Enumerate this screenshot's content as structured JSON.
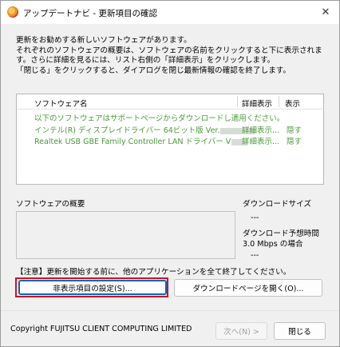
{
  "window": {
    "title": "アップデートナビ - 更新項目の確認",
    "close_glyph": "✕"
  },
  "description": "更新をお勧めする新しいソフトウェアがあります。\nそれぞれのソフトウェアの概要は、ソフトウェアの名前をクリックすると下に表示されます。さらに詳細を見るには、リスト右側の「詳細表示」をクリックします。\n「閉じる」をクリックすると、ダイアログを閉じ最新情報の確認を終了します。",
  "list": {
    "headers": {
      "name": "ソフトウェア名",
      "detail": "詳細表示",
      "display": "表示"
    },
    "rows": [
      {
        "name": "以下のソフトウェアはサポートページからダウンロードし適用ください。",
        "detail": "",
        "display": ""
      },
      {
        "name": "インテル(R) ディスプレイドライバー 64ビット版 Ver.",
        "detail": "詳細表示...",
        "display": "隠す"
      },
      {
        "name": "Realtek USB GBE Family Controller LAN ドライバー V",
        "detail": "詳細表示...",
        "display": "隠す"
      }
    ]
  },
  "overview": {
    "label": "ソフトウェアの概要"
  },
  "download": {
    "size_label": "ダウンロードサイズ",
    "size_value": "---",
    "time_label": "ダウンロード予想時間",
    "speed_label": "3.0 Mbps の場合",
    "time_value": "---"
  },
  "notice": "【注意】更新を開始する前に、他のアプリケーションを全て終了してください。",
  "buttons": {
    "hidden_settings": "非表示項目の設定(S)...",
    "download_page": "ダウンロードページを開く(O)...",
    "next": "次へ(N) >",
    "close": "閉じる"
  },
  "footer": {
    "copyright": "Copyright FUJITSU CLIENT COMPUTING LIMITED"
  },
  "colors": {
    "link_green": "#4a9a3a",
    "highlight_red": "#d0121b",
    "focus_blue": "#0067c0"
  }
}
